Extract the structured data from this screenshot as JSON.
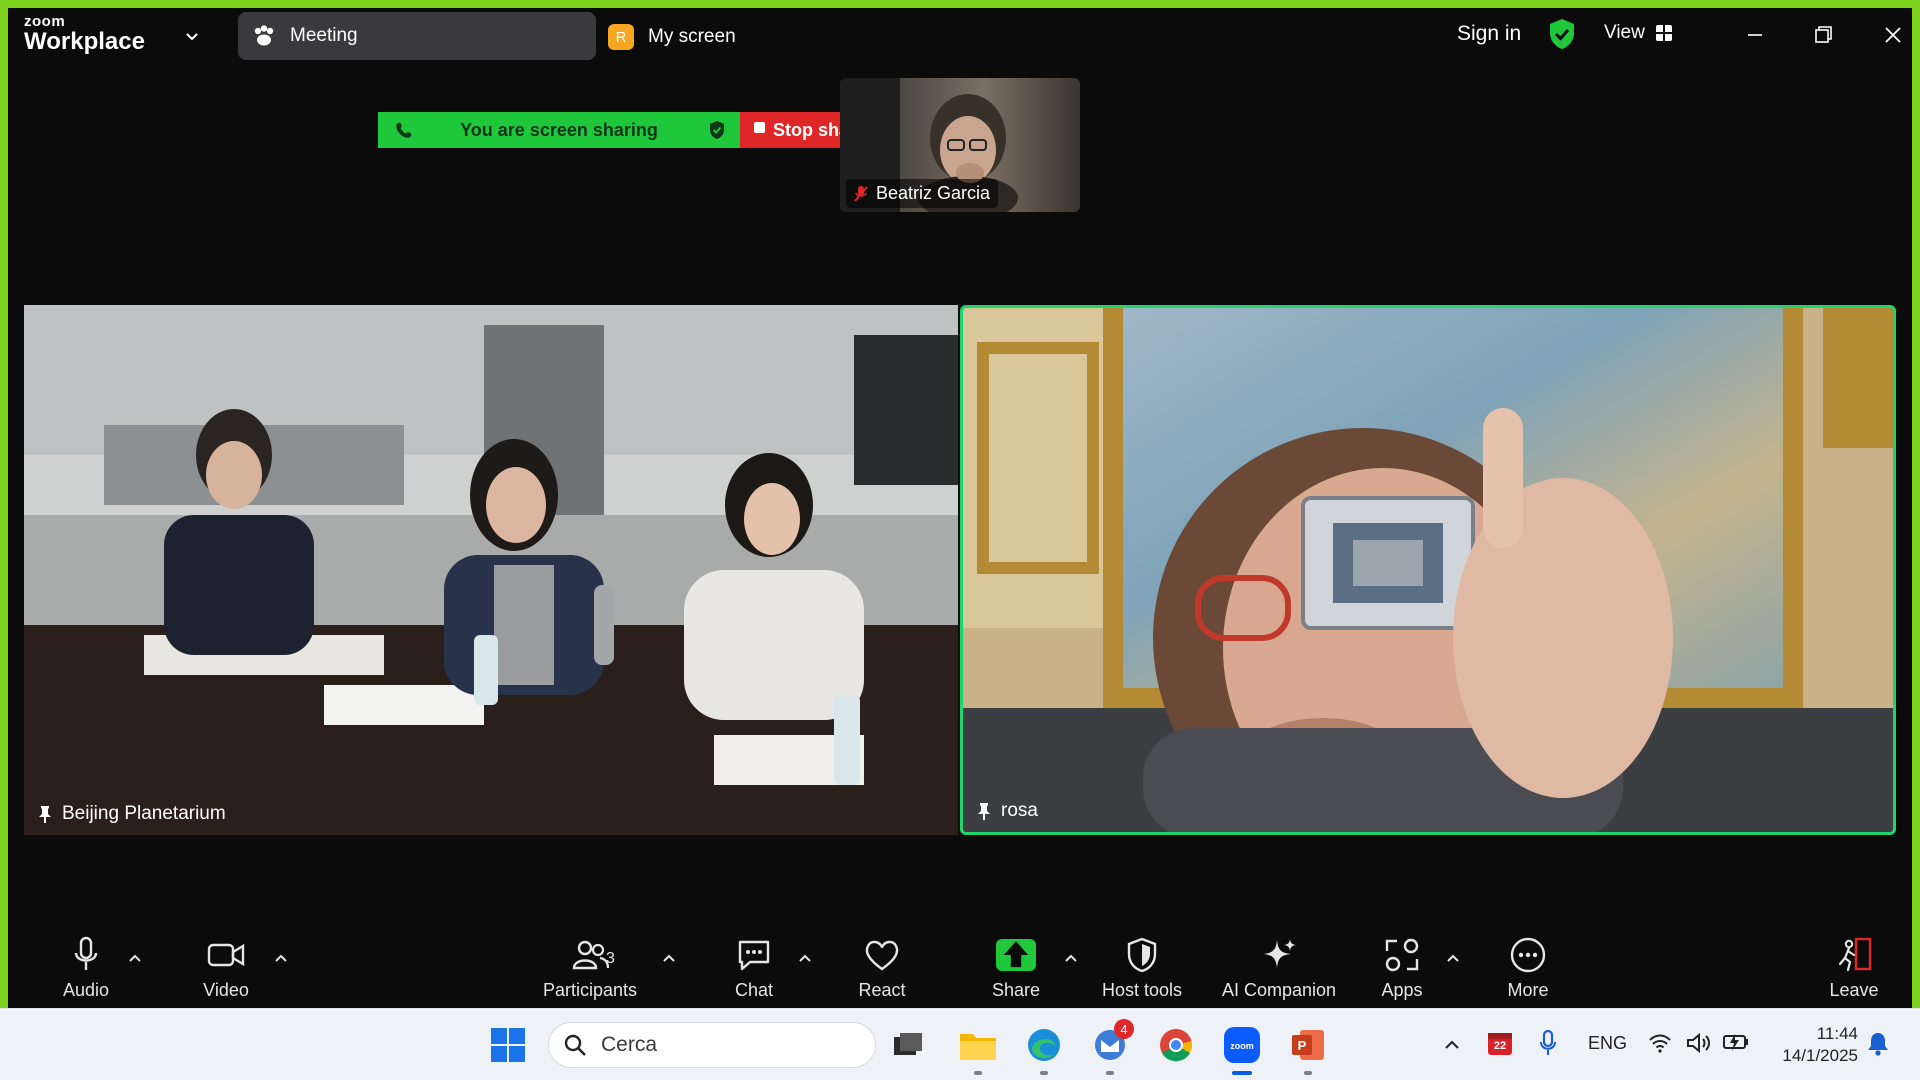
{
  "app": {
    "brand_small": "zoom",
    "brand_name": "Workplace"
  },
  "titlebar": {
    "meeting_tab": "Meeting",
    "my_screen_badge": "R",
    "my_screen_tab": "My screen",
    "sign_in": "Sign in",
    "view_label": "View"
  },
  "share_banner": {
    "message": "You are screen sharing",
    "stop_label": "Stop share"
  },
  "participants": {
    "thumbnail": {
      "name": "Beatriz Garcia",
      "muted": true
    },
    "left_tile": {
      "name": "Beijing Planetarium",
      "pinned": true
    },
    "right_tile": {
      "name": "rosa",
      "pinned": true,
      "active_speaker": true
    }
  },
  "toolbar": {
    "audio": "Audio",
    "video": "Video",
    "participants": "Participants",
    "participants_count": "3",
    "chat": "Chat",
    "react": "React",
    "share": "Share",
    "host_tools": "Host tools",
    "ai_companion": "AI Companion",
    "apps": "Apps",
    "more": "More",
    "leave": "Leave"
  },
  "taskbar": {
    "search_placeholder": "Cerca",
    "mail_badge": "4",
    "calendar_day": "22",
    "language": "ENG",
    "time": "11:44",
    "date": "14/1/2025"
  },
  "colors": {
    "share_green": "#1fc73a",
    "stop_red": "#e02727",
    "active_speaker_border": "#1ed66a",
    "frame_green": "#7ed321"
  }
}
